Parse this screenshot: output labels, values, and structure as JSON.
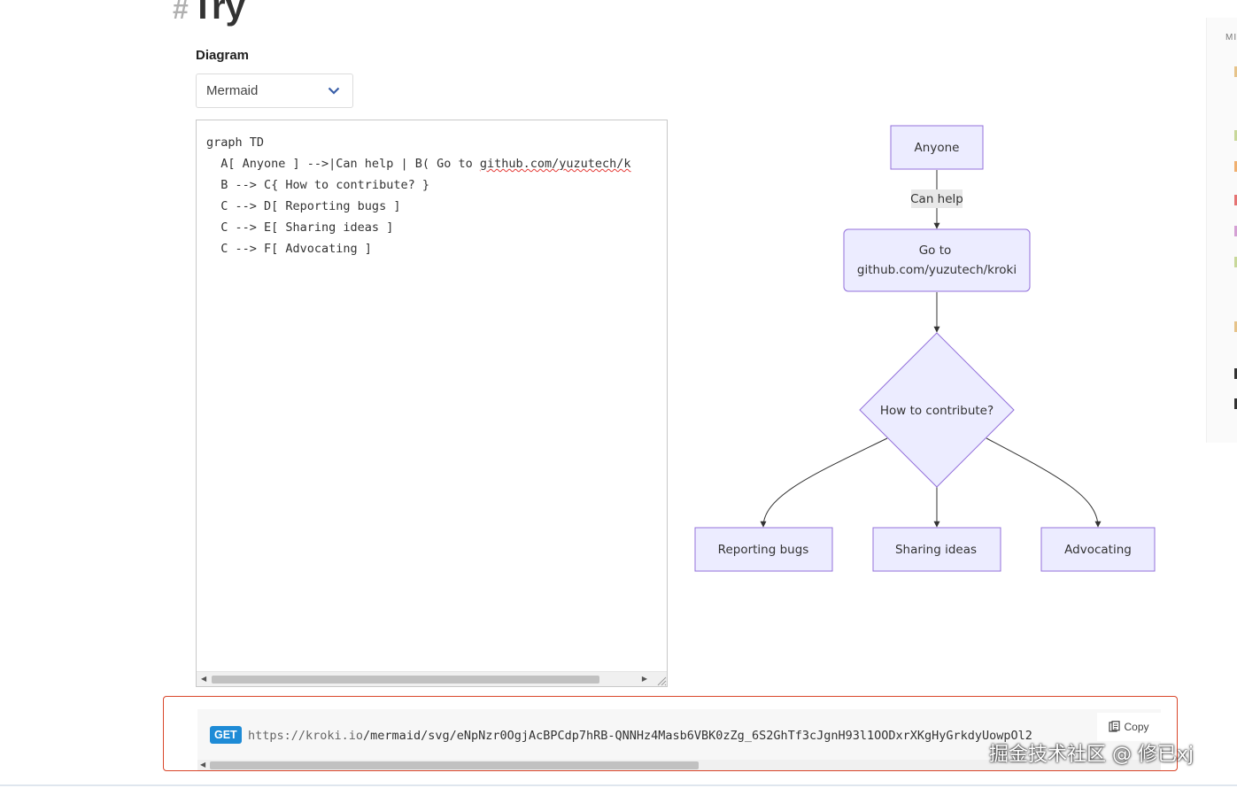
{
  "section": {
    "hash": "#",
    "title": "Try"
  },
  "diagram_label": "Diagram",
  "diagram_select": {
    "value": "Mermaid"
  },
  "editor": {
    "lines": [
      "graph TD",
      "  A[ Anyone ] -->|Can help | B( Go to ",
      "  B --> C{ How to contribute? }",
      "  C --> D[ Reporting bugs ]",
      "  C --> E[ Sharing ideas ]",
      "  C --> F[ Advocating ]"
    ],
    "line2_link": "github.com/yuzutech/k"
  },
  "preview": {
    "nodes": {
      "a": "Anyone",
      "b1": "Go to",
      "b2": "github.com/yuzutech/kroki",
      "c": "How to contribute?",
      "d": "Reporting bugs",
      "e": "Sharing ideas",
      "f": "Advocating"
    },
    "edge_label": "Can help",
    "colors": {
      "node_fill": "#ECECFF",
      "node_stroke": "#9370DB",
      "edge": "#333333",
      "edge_label_bg": "#e8e8e8"
    }
  },
  "url_panel": {
    "method": "GET",
    "url_host": "https://kroki.io",
    "url_path": "/mermaid/svg/eNpNzr0OgjAcBPCdp7hRB-QNNHz4Masb6VBK0zZg_6S2GhTf3cJgnH93l1OODxrXKgHyGrkdyUowpOl2",
    "copy_label": "Copy",
    "colors": {
      "border": "#d9462a",
      "badge": "#1e8bd6"
    }
  },
  "toc": {
    "title": "MI"
  },
  "watermark": "掘金技术社区 @ 修已xj"
}
